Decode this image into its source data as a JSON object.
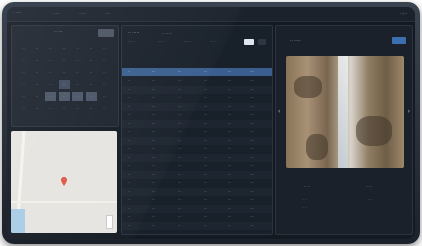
{
  "topbar": {
    "brand": "· ···",
    "menu": [
      "·····",
      "·····",
      "····"
    ],
    "clock": "··:··"
  },
  "calendar": {
    "title": "·· ···",
    "rows": [
      [
        "··",
        "··",
        "··",
        "··",
        "··",
        "··",
        "··"
      ],
      [
        "··",
        "··",
        "··",
        "··",
        "··",
        "··",
        "··"
      ],
      [
        "··",
        "··",
        "··",
        "··",
        "··",
        "··",
        "··"
      ],
      [
        "··",
        "··",
        "··",
        "··",
        "··",
        "··",
        "··"
      ],
      [
        "··",
        "··",
        "··",
        "··",
        "··",
        "··",
        "··"
      ],
      [
        "··",
        "··",
        "··",
        "··",
        "··",
        "··",
        "··"
      ]
    ]
  },
  "table_panel": {
    "title": "·· ·····",
    "subtitle": "········",
    "filters": [
      "······",
      "·····",
      "······",
      "·····"
    ],
    "columns": [
      "··",
      "···",
      "···",
      "···",
      "···",
      "····"
    ],
    "rows": [
      [
        "··",
        "···",
        "···",
        "···",
        "···",
        "····"
      ],
      [
        "··",
        "···",
        "···",
        "···",
        "···",
        "····"
      ],
      [
        "··",
        "···",
        "···",
        "···",
        "···",
        "····"
      ],
      [
        "··",
        "···",
        "···",
        "···",
        "···",
        "····"
      ],
      [
        "··",
        "···",
        "···",
        "···",
        "···",
        "····"
      ],
      [
        "··",
        "···",
        "···",
        "···",
        "···",
        "····"
      ],
      [
        "··",
        "···",
        "···",
        "···",
        "···",
        "····"
      ],
      [
        "··",
        "···",
        "···",
        "···",
        "···",
        "····"
      ],
      [
        "··",
        "···",
        "···",
        "···",
        "···",
        "····"
      ],
      [
        "··",
        "···",
        "···",
        "···",
        "···",
        "····"
      ],
      [
        "··",
        "···",
        "···",
        "···",
        "···",
        "····"
      ],
      [
        "··",
        "···",
        "···",
        "···",
        "···",
        "····"
      ],
      [
        "··",
        "···",
        "···",
        "···",
        "···",
        "····"
      ],
      [
        "··",
        "···",
        "···",
        "···",
        "···",
        "····"
      ],
      [
        "··",
        "···",
        "···",
        "···",
        "···",
        "····"
      ],
      [
        "··",
        "···",
        "···",
        "···",
        "···",
        "····"
      ],
      [
        "··",
        "···",
        "···",
        "···",
        "···",
        "····"
      ],
      [
        "··",
        "···",
        "···",
        "···",
        "···",
        "····"
      ]
    ]
  },
  "viewer": {
    "title": "·· ·····",
    "stat1_label": "·····",
    "stat1_vals": [
      "·· ··",
      "·· ··"
    ],
    "stat2_label": "·····",
    "stat2_vals": [
      "··· ·"
    ]
  },
  "colors": {
    "accent_blue": "#3b6fb0",
    "tag_yellow": "#d9b84a",
    "map_pin": "#e2553f"
  }
}
